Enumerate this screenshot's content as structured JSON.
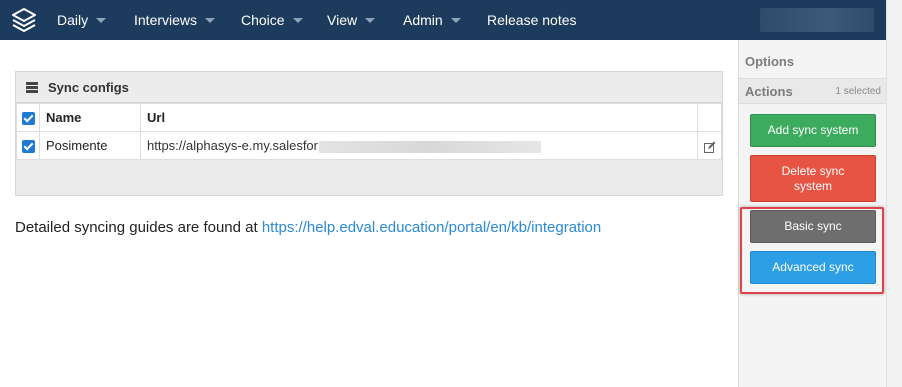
{
  "nav": {
    "items": [
      {
        "label": "Daily",
        "caret": true
      },
      {
        "label": "Interviews",
        "caret": true
      },
      {
        "label": "Choice",
        "caret": true
      },
      {
        "label": "View",
        "caret": true
      },
      {
        "label": "Admin",
        "caret": true
      },
      {
        "label": "Release notes",
        "caret": false
      }
    ]
  },
  "panel": {
    "title": "Sync configs",
    "columns": [
      "Name",
      "Url"
    ],
    "rows": [
      {
        "checked": true,
        "name": "Posimente",
        "url": "https://alphasys-e.my.salesfor"
      }
    ]
  },
  "guide": {
    "text": "Detailed syncing guides are found at ",
    "link": "https://help.edval.education/portal/en/kb/integration"
  },
  "side": {
    "title": "Options",
    "section_label": "Actions",
    "selected_count": "1 selected",
    "buttons": {
      "add": "Add sync system",
      "delete": "Delete sync system",
      "basic": "Basic sync",
      "advanced": "Advanced sync"
    }
  },
  "colors": {
    "navbar": "#1d3b5c",
    "green": "#3dab5e",
    "red": "#e85444",
    "grey": "#6e6e6e",
    "blue": "#2c9fe6",
    "link": "#2a8ad4",
    "highlight": "#e0424a"
  }
}
